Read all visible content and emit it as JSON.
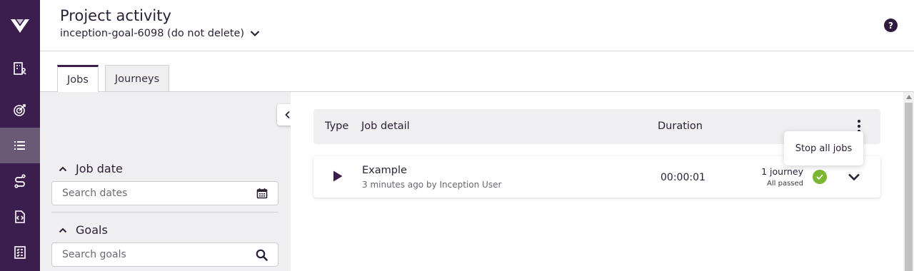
{
  "header": {
    "title": "Project activity",
    "project_name": "inception-goal-6098 (do not delete)",
    "help_glyph": "?"
  },
  "nav": {
    "items": [
      {
        "icon": "building-user-icon",
        "active": false
      },
      {
        "icon": "target-icon",
        "active": false
      },
      {
        "icon": "list-icon",
        "active": true
      },
      {
        "icon": "route-icon",
        "active": false
      },
      {
        "icon": "code-file-icon",
        "active": false
      },
      {
        "icon": "checklist-icon",
        "active": false
      }
    ]
  },
  "tabs": [
    {
      "label": "Jobs",
      "active": true
    },
    {
      "label": "Journeys",
      "active": false
    }
  ],
  "filters": {
    "job_date": {
      "label": "Job date",
      "placeholder": "Search dates"
    },
    "goals": {
      "label": "Goals",
      "placeholder": "Search goals"
    }
  },
  "table": {
    "headers": {
      "type": "Type",
      "detail": "Job detail",
      "duration": "Duration"
    },
    "menu": {
      "stop_all": "Stop all jobs"
    },
    "rows": [
      {
        "name": "Example",
        "subtitle": "3 minutes ago by Inception User",
        "duration": "00:00:01",
        "journeys": "1 journey",
        "status": "All passed"
      }
    ]
  },
  "colors": {
    "rail": "#3b1e4d",
    "rail_active": "#6a5a78",
    "pass": "#7cb731"
  }
}
